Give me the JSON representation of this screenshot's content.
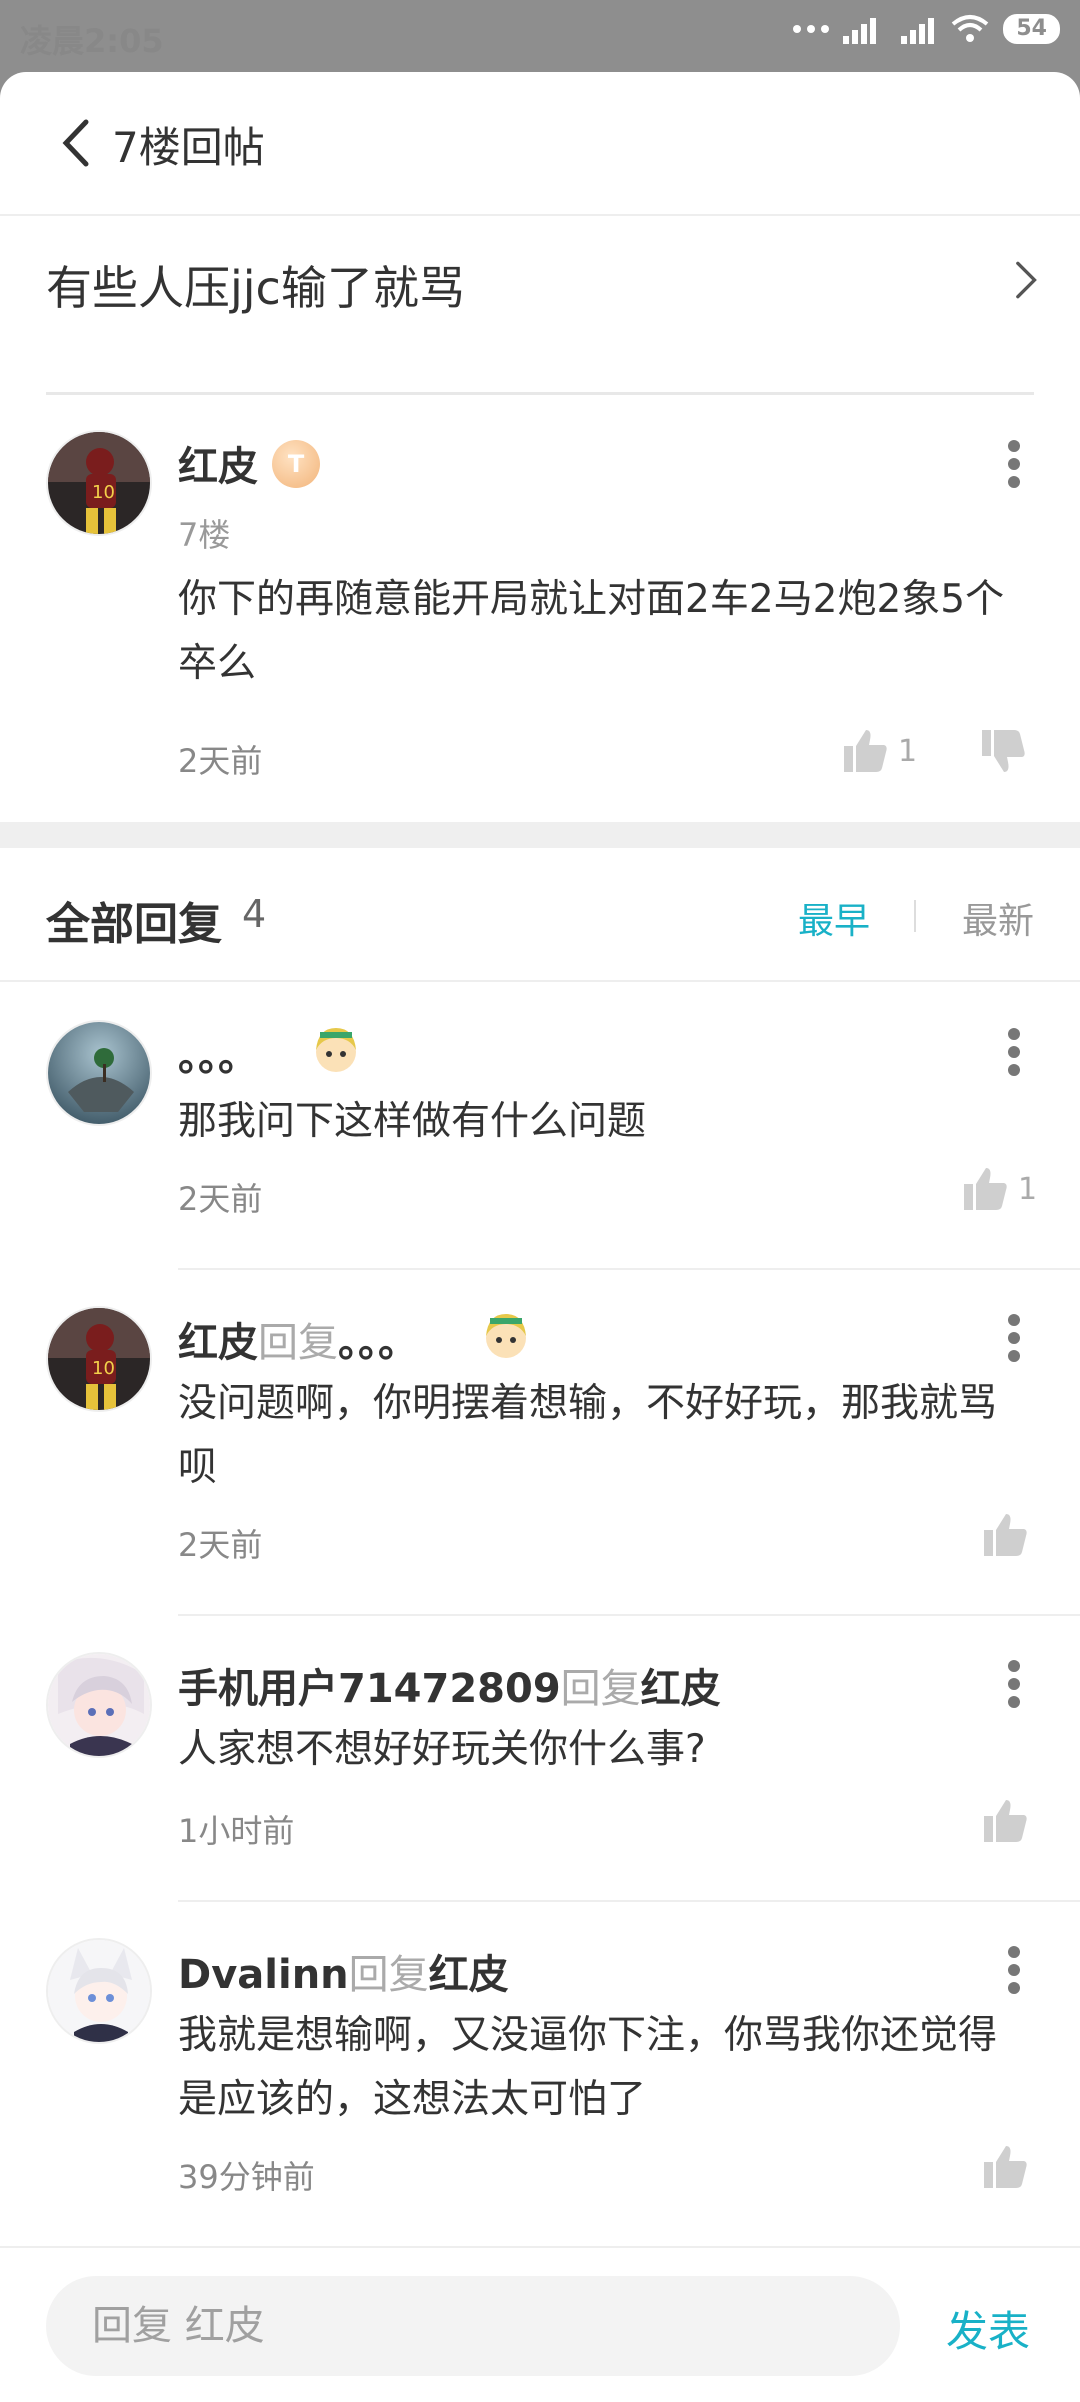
{
  "status_bar": {
    "time": "凌晨2:05",
    "battery": "54"
  },
  "header": {
    "title": "7楼回帖"
  },
  "topic": {
    "title": "有些人压jjc输了就骂"
  },
  "post": {
    "author": "红皮",
    "badge": "T",
    "floor": "7楼",
    "content": "你下的再随意能开局就让对面2车2马2炮2象5个卒么",
    "time": "2天前",
    "likes": "1"
  },
  "replies_header": {
    "title": "全部回复",
    "count": "4",
    "sort_earliest": "最早",
    "sort_latest": "最新"
  },
  "replies": [
    {
      "author": "。。。",
      "reply_word": "",
      "reply_to": "",
      "content": "那我问下这样做有什么问题",
      "time": "2天前",
      "likes": "1"
    },
    {
      "author": "红皮",
      "reply_word": "回复",
      "reply_to": "。。。",
      "content": "没问题啊，你明摆着想输，不好好玩，那我就骂呗",
      "time": "2天前",
      "likes": ""
    },
    {
      "author": "手机用户71472809",
      "reply_word": "回复",
      "reply_to": "红皮",
      "content": "人家想不想好好玩关你什么事?",
      "time": "1小时前",
      "likes": ""
    },
    {
      "author": "Dvalinn",
      "reply_word": "回复",
      "reply_to": "红皮",
      "content": "我就是想输啊，又没逼你下注，你骂我你还觉得是应该的，这想法太可怕了",
      "time": "39分钟前",
      "likes": ""
    }
  ],
  "composer": {
    "placeholder": "回复 红皮",
    "submit": "发表"
  },
  "colors": {
    "accent": "#19b1c7",
    "status_bar": "#8e8e8e"
  }
}
